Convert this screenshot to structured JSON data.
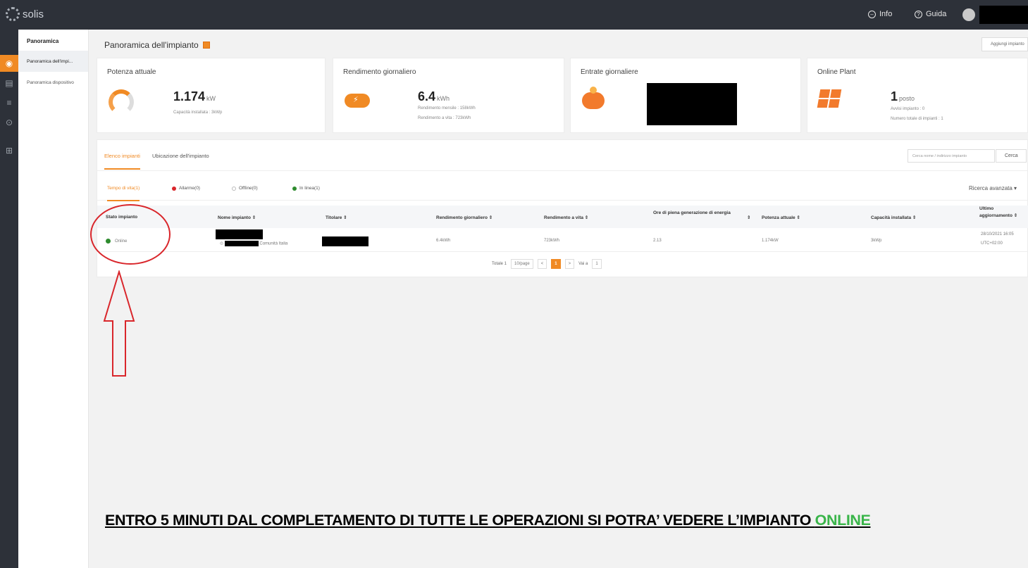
{
  "topbar": {
    "logo": "solis",
    "info": "Info",
    "help": "Guida"
  },
  "sidenav": {
    "head": "Panoramica",
    "items": [
      "Panoramica dell'impi...",
      "Panoramica dispositivo"
    ]
  },
  "page": {
    "title": "Panoramica dell'impianto",
    "add_button": "Aggiungi impianto"
  },
  "cards": [
    {
      "title": "Potenza attuale",
      "value": "1.174",
      "unit": "kW",
      "sub1": "Capacità installata : 3kWp",
      "sub2": ""
    },
    {
      "title": "Rendimento giornaliero",
      "value": "6.4",
      "unit": "kWh",
      "sub1": "Rendimento mensile : 158kWh",
      "sub2": "Rendimento a vita : 723kWh"
    },
    {
      "title": "Entrate giornaliere",
      "value": "",
      "unit": "",
      "sub1": "",
      "sub2": ""
    },
    {
      "title": "Online Plant",
      "value": "1",
      "unit": "posto",
      "sub1": "Avvisi impianto : 0",
      "sub2": "Numero totale di impianti : 1"
    }
  ],
  "tabs": [
    "Elenco impianti",
    "Ubicazione dell'impianto"
  ],
  "search": {
    "placeholder": "Cerca nome / indirizzo impianto",
    "button": "Cerca"
  },
  "filters": [
    {
      "label": "Tempo di vita(1)",
      "color": ""
    },
    {
      "label": "Allarme(0)",
      "color": "#d9262b"
    },
    {
      "label": "Offline(0)",
      "color": "#bbbbbb"
    },
    {
      "label": "In linea(1)",
      "color": "#2e8b2e"
    }
  ],
  "advanced_search": "Ricerca avanzata ▾",
  "table": {
    "headers": [
      "Stato impianto",
      "Nome impianto ⇕",
      "Titolare ⇕",
      "Rendimento giornaliero ⇕",
      "Rendimento a vita ⇕",
      "Ore di piena generazione di energia",
      "⇕",
      "Potenza attuale ⇕",
      "Capacità installata ⇕",
      "Ultimo aggiornamento ⇕"
    ],
    "row": {
      "status": "Online",
      "name_sub": "Comunità Italia",
      "daily": "6.4kWh",
      "lifetime": "723kWh",
      "hours": "2.13",
      "power": "1.174kW",
      "capacity": "3kWp",
      "updated_date": "28/10/2021 16:05",
      "updated_tz": "UTC+02:00"
    }
  },
  "pager": {
    "total": "Totale 1",
    "per_page": "10/page",
    "prev": "<",
    "current": "1",
    "next": ">",
    "goto": "Vai a",
    "goto_value": "1"
  },
  "caption": {
    "text": "ENTRO 5 MINUTI DAL COMPLETAMENTO DI TUTTE LE OPERAZIONI SI POTRA’ VEDERE L’IMPIANTO ",
    "highlight": "ONLINE"
  }
}
